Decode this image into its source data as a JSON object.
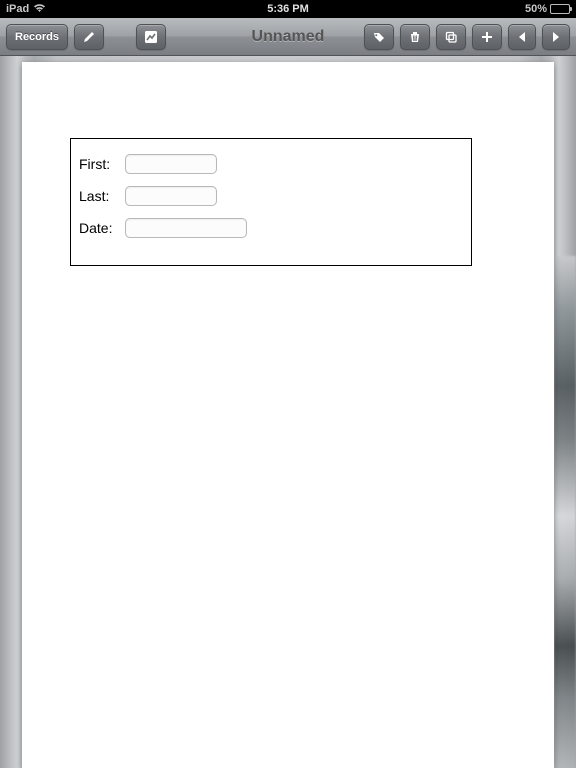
{
  "status_bar": {
    "device": "iPad",
    "time": "5:36 PM",
    "battery_text": "50%"
  },
  "toolbar": {
    "records_label": "Records",
    "title": "Unnamed"
  },
  "form": {
    "fields": {
      "first": {
        "label": "First:",
        "value": ""
      },
      "last": {
        "label": "Last:",
        "value": ""
      },
      "date": {
        "label": "Date:",
        "value": ""
      }
    }
  }
}
